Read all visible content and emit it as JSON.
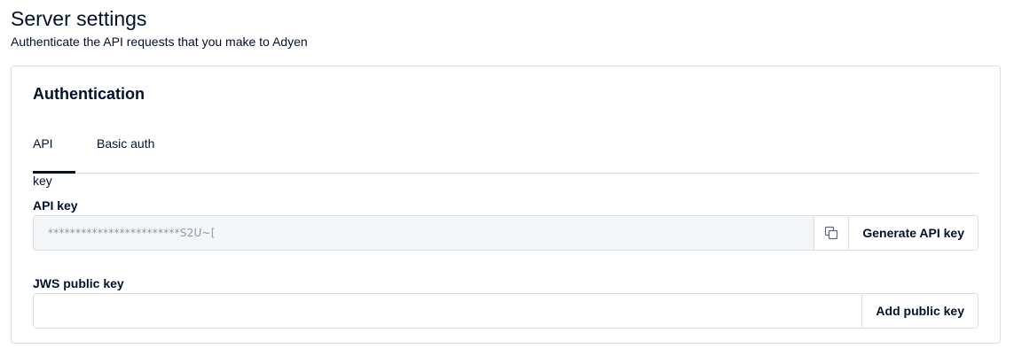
{
  "page": {
    "title": "Server settings",
    "subtitle": "Authenticate the API requests that you make to Adyen"
  },
  "card": {
    "title": "Authentication",
    "tabs": [
      {
        "label": "API key",
        "active": true
      },
      {
        "label": "Basic auth",
        "active": false
      }
    ]
  },
  "api_key": {
    "label": "API key",
    "value": "************************S2U~[",
    "copy_icon": "copy-icon",
    "generate_label": "Generate API key"
  },
  "jws_key": {
    "label": "JWS public key",
    "value": "",
    "placeholder": "",
    "add_label": "Add public key"
  },
  "colors": {
    "text": "#00112c",
    "border": "#dbdee2",
    "readonly_bg": "#f3f6f9",
    "muted_text": "#8d95a3"
  }
}
